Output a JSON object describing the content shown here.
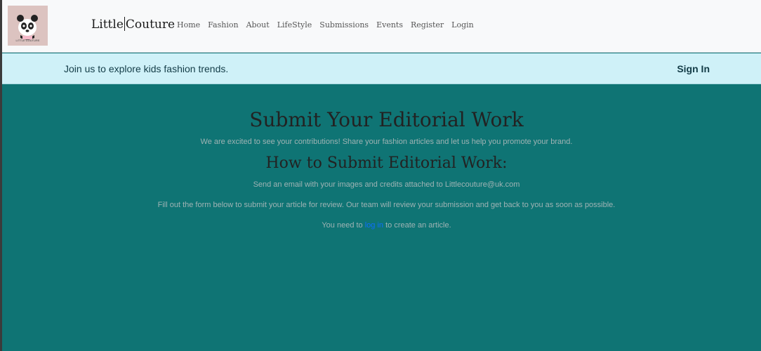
{
  "nav": {
    "brand_left": "Little",
    "brand_right": "Couture",
    "links": [
      "Home",
      "Fashion",
      "About",
      "LifeStyle",
      "Submissions",
      "Events",
      "Register",
      "Login"
    ]
  },
  "banner": {
    "text": "Join us to explore kids fashion trends.",
    "signin": "Sign In"
  },
  "main": {
    "title": "Submit Your Editorial Work",
    "intro": "We are excited to see your contributions! Share your fashion articles and let us help you promote your brand.",
    "subtitle": "How to Submit Editorial Work:",
    "email_line": "Send an email with your images and credits attached to Littlecouture@uk.com",
    "form_line": "Fill out the form below to submit your article for review. Our team will review your submission and get back to you as soon as possible.",
    "login_prefix": "You need to ",
    "login_link": "log in",
    "login_suffix": " to create an article."
  },
  "colors": {
    "background": "#0f7474",
    "banner": "#cff1f8",
    "navbar": "#f8f9fa",
    "link": "#0d6efd"
  }
}
